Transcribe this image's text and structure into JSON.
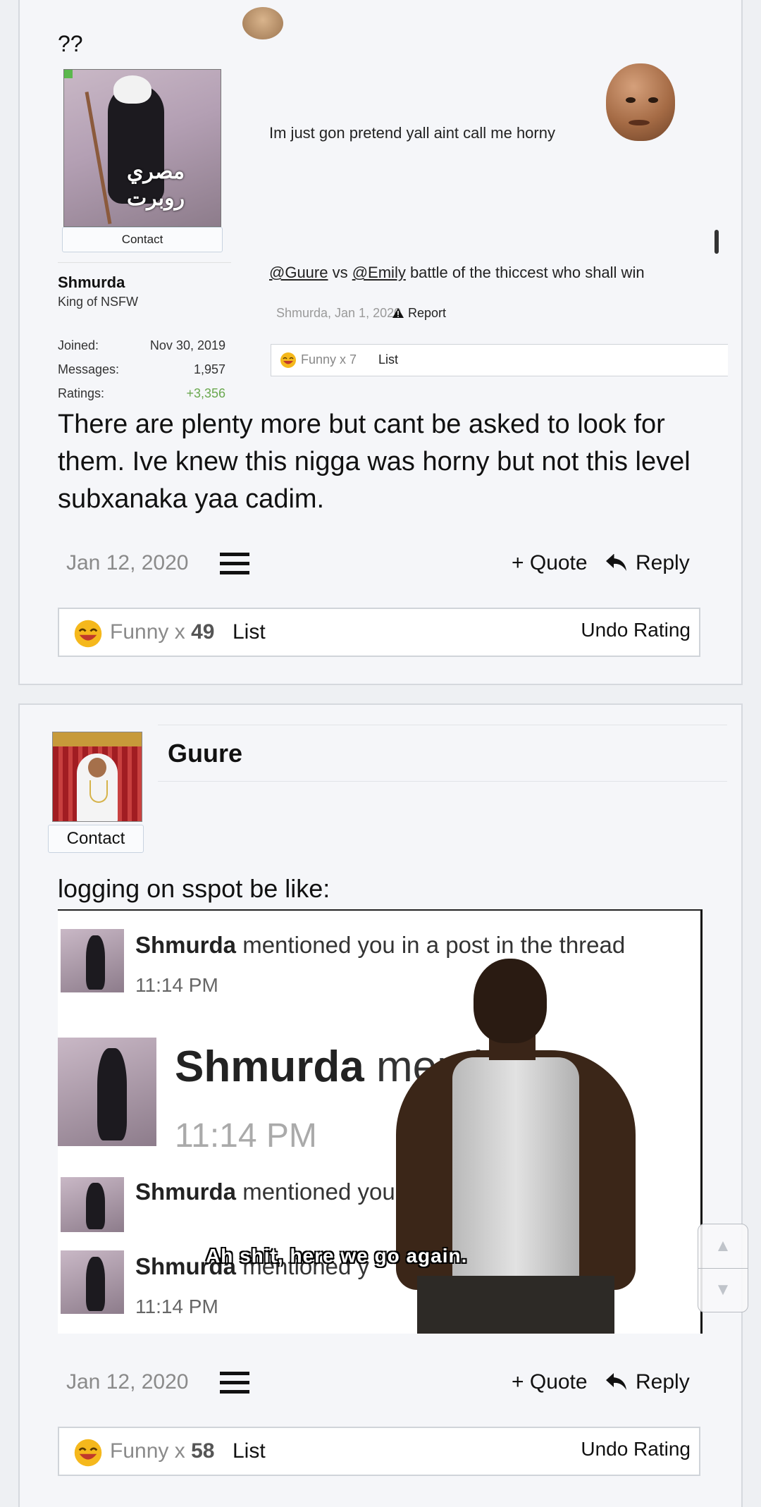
{
  "post1": {
    "quoted": {
      "qq": "??",
      "contact": "Contact",
      "username": "Shmurda",
      "user_title": "King of NSFW",
      "avatar_caption": "مصري\nروبرت",
      "stats": [
        {
          "label": "Joined:",
          "value": "Nov 30, 2019"
        },
        {
          "label": "Messages:",
          "value": "1,957"
        },
        {
          "label": "Ratings:",
          "value": "+3,356"
        }
      ],
      "text1": "Im just gon pretend yall aint call me horny",
      "mention1": "@Guure",
      "vs": " vs ",
      "mention2": "@Emily",
      "text2_rest": " battle of the thiccest who shall win",
      "meta": "Shmurda, Jan 1, 2020",
      "report": "Report",
      "rating_funny": "Funny x 7",
      "rating_list": "List"
    },
    "body": "There are plenty more but cant be asked to look for them. Ive knew this nigga was horny but not this level subxanaka yaa cadim.",
    "date": "Jan 12, 2020",
    "quote_label": "+ Quote",
    "reply_label": "Reply",
    "rating": {
      "label": "Funny x ",
      "count": "49",
      "list": "List",
      "undo": "Undo Rating"
    }
  },
  "post2": {
    "username": "Guure",
    "contact": "Contact",
    "body": "logging on sspot be like:",
    "meme": {
      "name": "Shmurda",
      "rest1": " mentioned you in a post in the thread",
      "rest2": " mentio",
      "rest3": " mentioned you",
      "rest4": " mentioned y",
      "time": "11:14 PM",
      "caption": "Ah shit, here we go again."
    },
    "date": "Jan 12, 2020",
    "quote_label": "+ Quote",
    "reply_label": "Reply",
    "rating": {
      "label": "Funny x ",
      "count": "58",
      "list": "List",
      "undo": "Undo Rating"
    }
  },
  "icons": {
    "menu": "hamburger-icon",
    "reply": "reply-arrow-icon",
    "emoji": "laughing-emoji-icon",
    "warning": "warning-triangle-icon",
    "scroll_up": "▲",
    "scroll_down": "▼"
  }
}
